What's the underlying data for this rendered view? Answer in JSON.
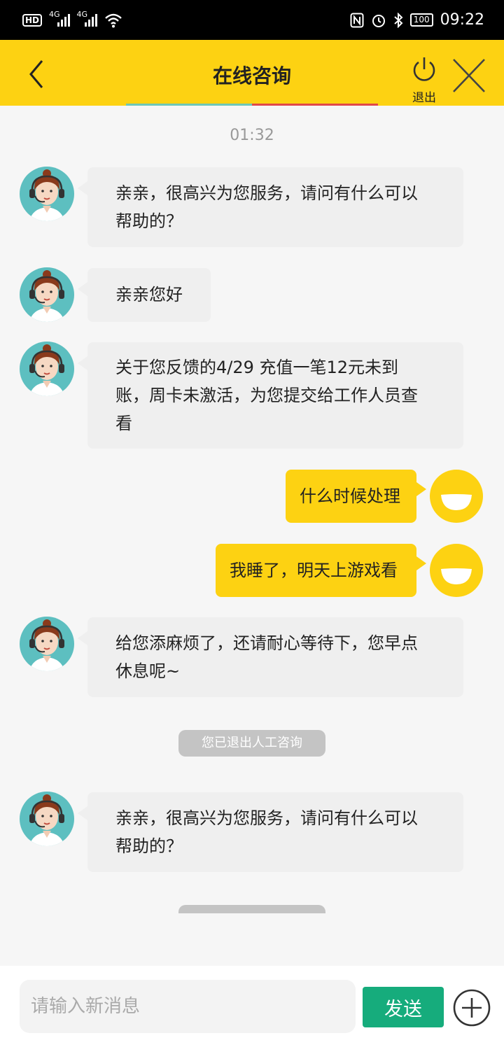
{
  "status_bar": {
    "hd": "HD",
    "net1": "4G",
    "net2": "4G",
    "battery": "100",
    "time": "09:22"
  },
  "header": {
    "title": "在线咨询",
    "exit_label": "退出",
    "tab_colors": [
      "#6dc7b6",
      "#e04848",
      "#fdd212"
    ]
  },
  "chat": {
    "timestamp": "01:32",
    "messages": [
      {
        "from": "agent",
        "text_lines": [
          "亲亲，很高兴为您服务，请问有什么可以",
          "帮助的？"
        ]
      },
      {
        "from": "agent",
        "text_lines": [
          "亲亲您好"
        ]
      },
      {
        "from": "agent",
        "text_lines": [
          "关于您反馈的4/29 充值一笔12元未到",
          "账，周卡未激活，为您提交给工作人员查",
          "看"
        ]
      },
      {
        "from": "user",
        "text_lines": [
          "什么时候处理"
        ]
      },
      {
        "from": "user",
        "text_lines": [
          "我睡了，明天上游戏看"
        ]
      },
      {
        "from": "agent",
        "text_lines": [
          "给您添麻烦了，还请耐心等待下，您早点",
          "休息呢~"
        ]
      },
      {
        "from": "agent",
        "text_lines": [
          "亲亲，很高兴为您服务，请问有什么可以",
          "帮助的？"
        ]
      }
    ],
    "system_notice": "您已退出人工咨询"
  },
  "input": {
    "placeholder": "请输入新消息",
    "value": "",
    "send_label": "发送"
  },
  "colors": {
    "accent": "#fdd212",
    "send": "#16ac7c",
    "agent_bubble": "#efefef"
  }
}
